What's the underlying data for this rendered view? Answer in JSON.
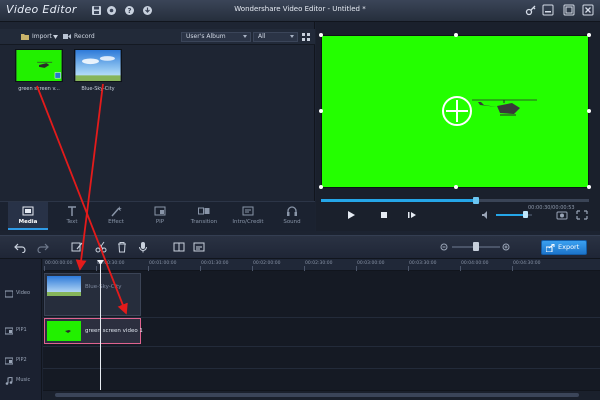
{
  "app": {
    "logo_text": "Video Editor",
    "window_title": "Wondershare Video Editor - Untitled *"
  },
  "media_toolbar": {
    "import_label": "Import",
    "record_label": "Record",
    "album_select": "User's Album",
    "filter_select": "All"
  },
  "media_clips": [
    {
      "name": "green screen v...",
      "kind": "green-screen-helicopter"
    },
    {
      "name": "Blue-Sky-City",
      "kind": "blue-sky-city"
    }
  ],
  "module_tabs": [
    {
      "label": "Media",
      "icon": "film-icon",
      "active": true
    },
    {
      "label": "Text",
      "icon": "text-icon",
      "active": false
    },
    {
      "label": "Effect",
      "icon": "magic-wand-icon",
      "active": false
    },
    {
      "label": "PIP",
      "icon": "pip-icon",
      "active": false
    },
    {
      "label": "Transition",
      "icon": "transition-icon",
      "active": false
    },
    {
      "label": "Intro/Credit",
      "icon": "intro-credit-icon",
      "active": false
    },
    {
      "label": "Sound",
      "icon": "headphones-icon",
      "active": false
    }
  ],
  "preview": {
    "time": "00:00:30/00:00:53",
    "progress": 0.58,
    "volume": 0.8,
    "screen_color": "#24ff00"
  },
  "timeline_toolbar": {
    "export_label": "Export",
    "zoom": 0.5
  },
  "ruler_ticks": [
    "00:00:00:00",
    "00:00:30:00",
    "00:01:00:00",
    "00:01:30:00",
    "00:02:00:00",
    "00:02:30:00",
    "00:03:00:00",
    "00:03:30:00",
    "00:04:00:00",
    "00:04:30:00"
  ],
  "tracks": [
    {
      "label": "Video",
      "icon": "video-track-icon"
    },
    {
      "label": "PIP1",
      "icon": "pip-track-icon"
    },
    {
      "label": "PIP2",
      "icon": "pip-track-icon"
    },
    {
      "label": "Music",
      "icon": "music-icon"
    }
  ],
  "timeline_clips": {
    "video": "Blue-Sky-City",
    "pip1": "green screen video 1"
  },
  "colors": {
    "accent": "#25a6e8",
    "export": "#1d74c9",
    "annotation_arrow": "#e31b1b",
    "pip_clip_border": "#e0638f",
    "green_screen": "#24ff00"
  }
}
